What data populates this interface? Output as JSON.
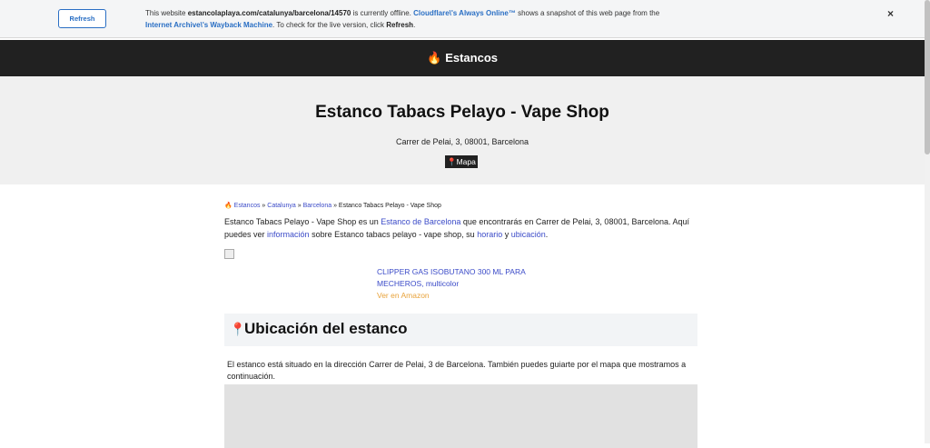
{
  "banner": {
    "refresh_label": "Refresh",
    "line1_pre": "This website ",
    "line1_url": "estancolaplaya.com/catalunya/barcelona/14570",
    "line1_mid": " is currently offline. ",
    "line1_cf": "Cloudflare\\'s Always Online™",
    "line1_post": " shows a snapshot of this web page from the",
    "line2_ia": "Internet Archive\\'s Wayback Machine",
    "line2_mid": ". To check for the live version, click ",
    "line2_refresh": "Refresh",
    "line2_end": ".",
    "close_label": "×"
  },
  "nav": {
    "brand": "Estancos"
  },
  "hero": {
    "title": "Estanco Tabacs Pelayo - Vape Shop",
    "address": "Carrer de Pelai, 3, 08001, Barcelona",
    "map_label": "Mapa"
  },
  "breadcrumb": {
    "items": [
      "Estancos",
      "Catalunya",
      "Barcelona"
    ],
    "separator": " » ",
    "current": "Estanco Tabacs Pelayo - Vape Shop"
  },
  "intro": {
    "p1": "Estanco Tabacs Pelayo - Vape Shop es un ",
    "link1": "Estanco de Barcelona",
    "p2": " que encontrarás en Carrer de Pelai, 3, 08001, Barcelona. Aquí puedes ver ",
    "link2": "información",
    "p3": " sobre Estanco tabacs pelayo - vape shop, su ",
    "link3": "horario",
    "p4": " y ",
    "link4": "ubicación",
    "p5": "."
  },
  "product": {
    "name": "CLIPPER GAS ISOBUTANO 300 ML PARA MECHEROS, multicolor",
    "cta": "Ver en Amazon"
  },
  "ubicacion": {
    "heading": "Ubicación del estanco",
    "text": "El estanco está situado en la dirección Carrer de Pelai, 3 de Barcelona. También puedes guiarte por el mapa que mostramos a continuación."
  },
  "icons": {
    "fire": "fire-icon",
    "pin": "pin-icon",
    "close": "close-icon"
  }
}
